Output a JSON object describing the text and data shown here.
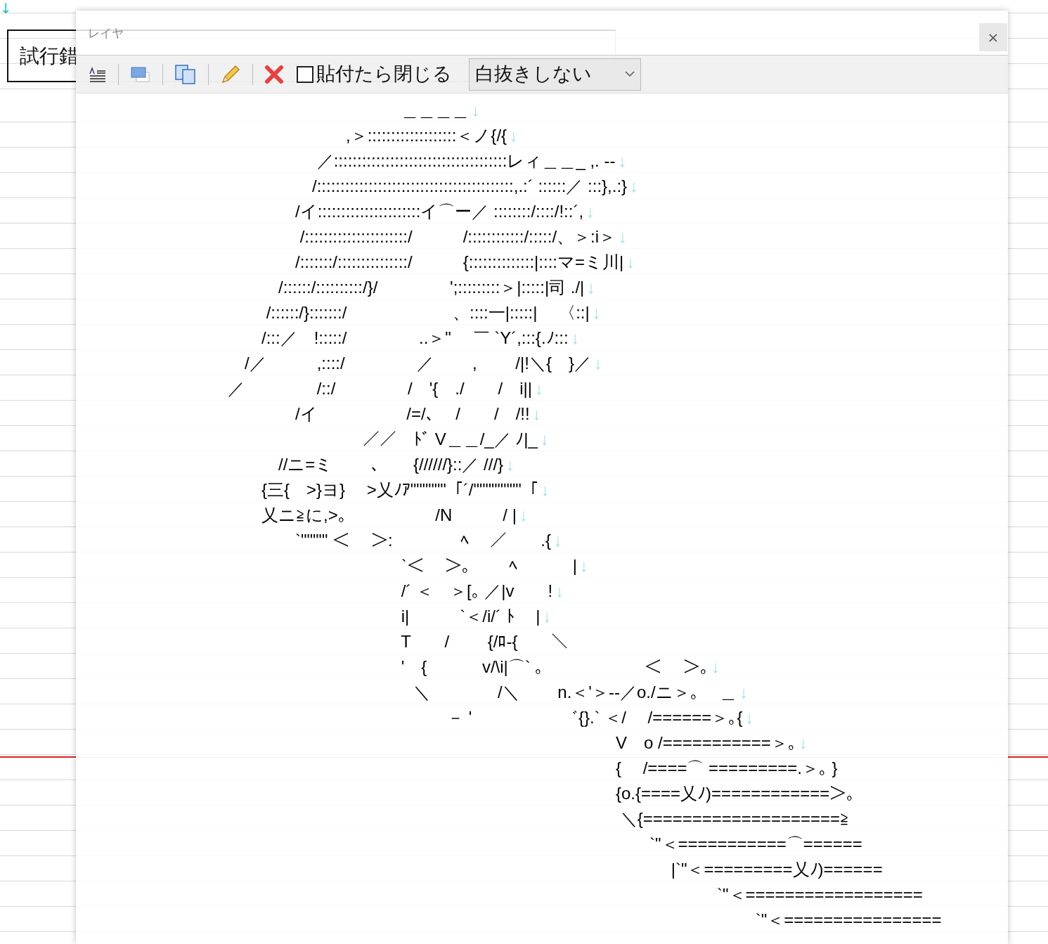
{
  "document": {
    "top_mark": "↓",
    "title": "試行錯"
  },
  "layer_window": {
    "title": "レイヤ",
    "close_label": "×",
    "tools": [
      {
        "kind": "format"
      },
      {
        "kind": "window"
      },
      {
        "kind": "copy"
      },
      {
        "kind": "edit"
      },
      {
        "kind": "delete"
      }
    ],
    "close_on_paste": {
      "label": "貼付たら閉じる",
      "checked": false
    },
    "fill_mode": {
      "value": "白抜きしない"
    },
    "art_lines": [
      {
        "text": "　　　　　　　　　　　　　　　　　　　 ＿＿＿＿",
        "end_mark": "↓"
      },
      {
        "text": "　　　　　　　　　　　　　　　　,＞:::::::::::::::::::＜ノ{/{",
        "end_mark": "↓"
      },
      {
        "text": "　　　　　　　　　　　　　　 ／:::::::::::::::::::::::::::::::::::::レィ＿＿_ ,. --",
        "end_mark": "↓"
      },
      {
        "text": "　　　　　　　　　　　　　　/::::::::::::::::::::::::::::::::::::::::::,.:´ ::::::／ :::},.:}",
        "end_mark": "↓"
      },
      {
        "text": "　　　　　　　　　　　　　/イ::::::::::::::::::::::イ⌒ー／ ::::::::/::::/!::´,",
        "end_mark": "↓"
      },
      {
        "text": "　　　　　　　　　　　　　 /::::::::::::::::::::::/　　　/::::::::::::/:::::/、＞:i＞",
        "end_mark": "↓"
      },
      {
        "text": "　　　　　　　　　　　　　/:::::::/:::::::::::::::/　　　{::::::::::::::|::::マ=ミ川|",
        "end_mark": "↓"
      },
      {
        "text": "　　　　　　　　　　　　/::::::/::::::::::/}/　　　　 ';:::::::::＞|:::::|司 ./|",
        "end_mark": "↓"
      },
      {
        "text": "　　　　　　　　　　　 /::::::/}:::::::/　　　　　　 、::::一|:::::|　 〈::|",
        "end_mark": "↓"
      },
      {
        "text": "　　　　　　　　　　　/:::／　!:::::/　　　　 ..＞\"　 ￣ `Y´,:::{.ﾉ:::",
        "end_mark": "↓"
      },
      {
        "text": "　　　　　　　　　　/／　　　,::::/　　　　 ／　　 ,　　 /|!＼{　}／",
        "end_mark": "↓"
      },
      {
        "text": "　　　　　　　　　／　　　　 /::/　　　　 /　'{　./　　/　i||",
        "end_mark": "↓"
      },
      {
        "text": "　　　　　　　　　　　　　/イ　　　　　 /=/､　 /　　/　/!!",
        "end_mark": "↓"
      },
      {
        "text": "　　　　　　　　　　　　　　　　　／／　ﾄﾞ V＿＿/_／ ﾉ|_",
        "end_mark": "↓"
      },
      {
        "text": "　　　　　　　　　　　　//ニ=ミ　　 ､　　{//////}::／ ///}",
        "end_mark": "↓"
      },
      {
        "text": "　　　　　　　　　　　{三{　>}ヨ}　 >乂ﾉｱ\"\"\"\"\"\"「´/\"\"\"\"\"\"\"\"「",
        "end_mark": "↓"
      },
      {
        "text": "　　　　　　　　　　　乂ニ≧に,>｡　　　　　 /N　　　/ |",
        "end_mark": "↓"
      },
      {
        "text": "　　　　　　　　　　　　　`\"\"\"\"' ＜　 ＞:　　　　ﾍ　 ／　　.{",
        "end_mark": "↓"
      },
      {
        "text": "　　　　　　　　　　　　　　　　　　　 `＜　 ＞｡　　 ﾍ　　　 |",
        "end_mark": "↓"
      },
      {
        "text": "　　　　　　　　　　　　　　　　　　　 /´ ＜　＞[｡ ／|v　　!",
        "end_mark": "↓"
      },
      {
        "text": "　　　　　　　　　　　　　　　　　　　 i|　　　`＜/i/´ ﾄ　 |",
        "end_mark": "↓"
      },
      {
        "text": "　　　　　　　　　　　　　　　　　　　 T　　/　　 {/ﾛ-{　　＼"
      },
      {
        "text": "　　　　　　　　　　　　　　　　　　　 '　{　　　 v/\\i|⌒` ｡　　　　　　＜　 ＞｡",
        "end_mark": "↓"
      },
      {
        "text": "　　　　　　　　　　　　　　　　　　　　＼　　　　/＼　　 n.＜'＞--／o./ニ＞｡　 ＿",
        "end_mark": "↓"
      },
      {
        "text": "　　　　　　　　　　　　　　　　　　　　　　－ '　　　　　 ゛{}.` ＜/　 /======＞｡{",
        "end_mark": "↓"
      },
      {
        "text": "　　　　　　　　　　　　　　　　　　　　　　　　　　　　　　　　V　o /===========＞｡",
        "end_mark": "↓"
      },
      {
        "text": "　　　　　　　　　　　　　　　　　　　　　　　　　　　　　　　　{　 /====⌒ =========.＞｡ }"
      },
      {
        "text": "　　　　　　　　　　　　　　　　　　　　　　　　　　　　　　　　{o.{====乂ﾉ)============＞｡"
      },
      {
        "text": "　　　　　　　　　　　　　　　　　　　　　　　　　　　　　　　　 ＼{====================≧"
      },
      {
        "text": "　　　　　　　　　　　　　　　　　　　　　　　　　　　　　　　　　　`\"＜===========⌒======"
      },
      {
        "text": "　　　　　　　　　　　　　　　　　　　　　　　　　　　　　　　　　　　 |`\"＜=========乂ﾉ)======"
      },
      {
        "text": "　　　　　　　　　　　　　　　　　　　　　　　　　　　　　　　　　　　　　　`\"＜=================="
      },
      {
        "text": "　　　　　　　　　　　　　　　　　　　　　　　　　　　　　　　　　　　　　　　　 `\"＜================"
      }
    ]
  }
}
